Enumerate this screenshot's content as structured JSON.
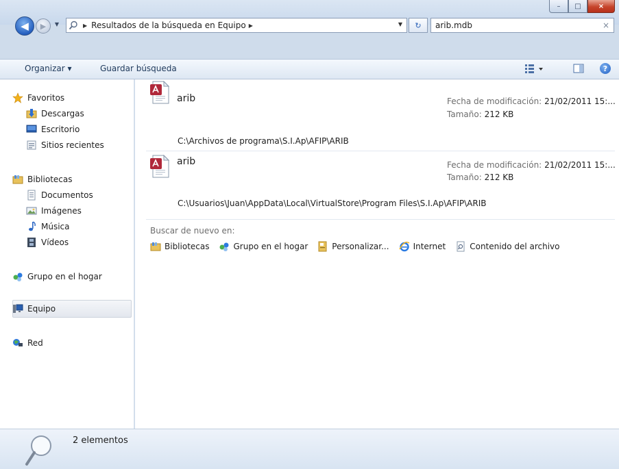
{
  "window": {
    "caption": {
      "minimize": "–",
      "maximize": "□",
      "close": "×"
    }
  },
  "nav": {
    "back_glyph": "◀",
    "forward_glyph": "▶",
    "address": {
      "crumb": "Resultados de la búsqueda en Equipo"
    },
    "search": {
      "value": "arib.mdb"
    }
  },
  "toolbar": {
    "organize": "Organizar ▾",
    "save_search": "Guardar búsqueda",
    "help": "?"
  },
  "sidebar": {
    "favorites": {
      "title": "Favoritos",
      "items": [
        "Descargas",
        "Escritorio",
        "Sitios recientes"
      ]
    },
    "libraries": {
      "title": "Bibliotecas",
      "items": [
        "Documentos",
        "Imágenes",
        "Música",
        "Vídeos"
      ]
    },
    "homegroup": "Grupo en el hogar",
    "computer": "Equipo",
    "network": "Red"
  },
  "results": [
    {
      "name": "arib",
      "modified_label": "Fecha de modificación:",
      "modified_value": "21/02/2011 15:...",
      "size_label": "Tamaño:",
      "size_value": "212 KB",
      "path": "C:\\Archivos de programa\\S.I.Ap\\AFIP\\ARIB"
    },
    {
      "name": "arib",
      "modified_label": "Fecha de modificación:",
      "modified_value": "21/02/2011 15:...",
      "size_label": "Tamaño:",
      "size_value": "212 KB",
      "path": "C:\\Usuarios\\Juan\\AppData\\Local\\VirtualStore\\Program Files\\S.I.Ap\\AFIP\\ARIB"
    }
  ],
  "search_again": {
    "title": "Buscar de nuevo en:",
    "options": [
      "Bibliotecas",
      "Grupo en el hogar",
      "Personalizar...",
      "Internet",
      "Contenido del archivo"
    ]
  },
  "status": {
    "count": "2 elementos"
  },
  "colors": {
    "accent": "#1f5fc4",
    "toolbar_text": "#1e395b",
    "meta_gray": "#6d6d6d"
  }
}
